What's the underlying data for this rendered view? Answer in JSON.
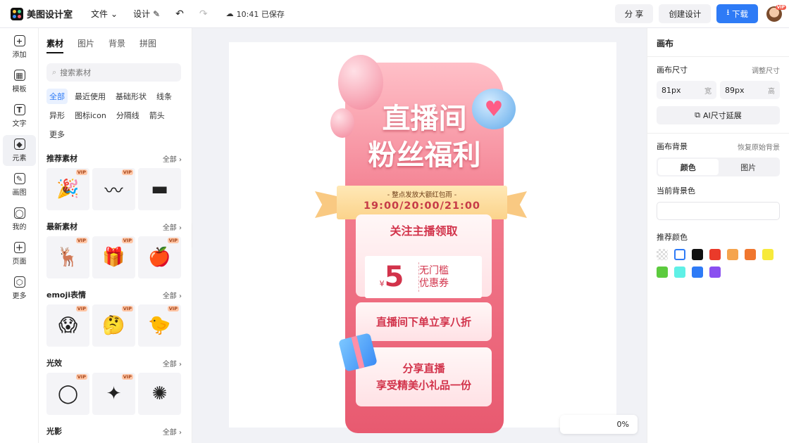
{
  "topbar": {
    "app_name": "美图设计室",
    "menu": [
      "文件",
      "设计"
    ],
    "save_status": "10:41 已保存",
    "share_label": "分 享",
    "create_label": "创建设计",
    "download_label": "下载",
    "avatar_badge": "VIP"
  },
  "rail": [
    {
      "label": "添加",
      "icon": "add-icon",
      "glyph": "+"
    },
    {
      "label": "模板",
      "icon": "template-icon",
      "glyph": "▦"
    },
    {
      "label": "文字",
      "icon": "text-icon",
      "glyph": "T"
    },
    {
      "label": "元素",
      "icon": "element-icon",
      "glyph": "◆"
    },
    {
      "label": "画图",
      "icon": "draw-icon",
      "glyph": "✎"
    },
    {
      "label": "我的",
      "icon": "user-icon",
      "glyph": "◯"
    },
    {
      "label": "页面",
      "icon": "page-icon",
      "glyph": "＋"
    },
    {
      "label": "更多",
      "icon": "more-icon",
      "glyph": "⬡"
    }
  ],
  "panel": {
    "tabs": [
      "素材",
      "图片",
      "背景",
      "拼图"
    ],
    "search_placeholder": "搜索素材",
    "chips": [
      "全部",
      "最近使用",
      "基础形状",
      "线条",
      "异形",
      "图标icon",
      "分隔线",
      "箭头",
      "更多"
    ],
    "more_link": "全部",
    "sections": [
      {
        "title": "推荐素材",
        "items": [
          "🎉",
          "〰",
          "▬"
        ]
      },
      {
        "title": "最新素材",
        "items": [
          "🦌",
          "🎁",
          "🍎"
        ]
      },
      {
        "title": "emoji表情",
        "items": [
          "😱",
          "🤔",
          "🐤"
        ]
      },
      {
        "title": "光效",
        "items": [
          "◯",
          "✦",
          "✺"
        ]
      },
      {
        "title": "光影",
        "items": []
      }
    ],
    "vip": "VIP"
  },
  "poster": {
    "title1": "直播间",
    "title2": "粉丝福利",
    "ribbon_line1": "- 整点发放大额红包雨 -",
    "ribbon_line2": "19:00/20:00/21:00",
    "card1_title": "关注主播领取",
    "coupon_currency": "¥",
    "coupon_amount": "5",
    "coupon_line1": "无门槛",
    "coupon_line2": "优惠券",
    "card2_title": "直播间下单立享八折",
    "card3_line1": "分享直播",
    "card3_line2": "享受精美小礼品一份"
  },
  "zoom": "0%",
  "right": {
    "title": "画布",
    "size_label": "画布尺寸",
    "resize_link": "调整尺寸",
    "width_value": "81px",
    "width_unit": "宽",
    "height_value": "89px",
    "height_unit": "高",
    "ai_extend": "AI尺寸延展",
    "bg_label": "画布背景",
    "restore_link": "恢复原始背景",
    "seg": [
      "颜色",
      "图片"
    ],
    "current_bg_label": "当前背景色",
    "recommend_label": "推荐颜色",
    "swatches": [
      "#e8e8e8",
      "#ffffff",
      "#111111",
      "#ea3a2a",
      "#f5a44d",
      "#f0762e",
      "#f7ea3b",
      "#5ccb3e",
      "#5ff0e6",
      "#2e7bf6",
      "#8a4ff0"
    ]
  }
}
